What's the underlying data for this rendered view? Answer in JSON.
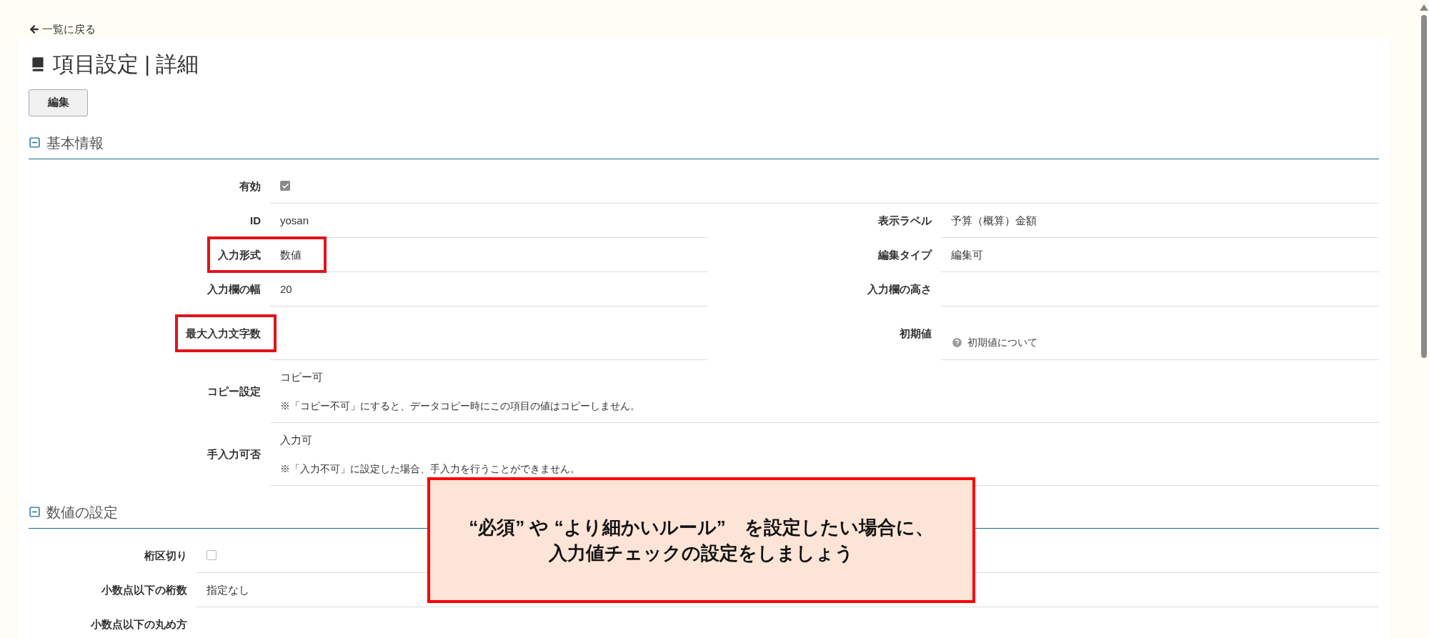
{
  "back_link": "一覧に戻る",
  "title": "項目設定 | 詳細",
  "edit_button": "編集",
  "sections": [
    {
      "title": "基本情報",
      "expanded": true,
      "rows": [
        {
          "left": {
            "label": "有効",
            "kind": "checkbox",
            "checked": true
          }
        },
        {
          "left": {
            "label": "ID",
            "kind": "text",
            "value": "yosan"
          },
          "right": {
            "label": "表示ラベル",
            "kind": "text",
            "value": "予算（概算）金額"
          }
        },
        {
          "left": {
            "label": "入力形式",
            "kind": "text",
            "value": "数値",
            "label_highlighted": true,
            "value_highlighted": true
          },
          "right": {
            "label": "編集タイプ",
            "kind": "text",
            "value": "編集可"
          }
        },
        {
          "left": {
            "label": "入力欄の幅",
            "kind": "text",
            "value": "20"
          },
          "right": {
            "label": "入力欄の高さ",
            "kind": "text"
          }
        },
        {
          "left": {
            "label": "最大入力文字数",
            "kind": "text",
            "label_highlighted": true,
            "value_highlighted": false
          },
          "right": {
            "label": "初期値",
            "kind": "help",
            "link": "初期値について"
          }
        },
        {
          "left": {
            "label": "コピー設定",
            "kind": "text",
            "value": "コピー可",
            "note": "※「コピー不可」にすると、データコピー時にこの項目の値はコピーしません。"
          }
        },
        {
          "left": {
            "label": "手入力可否",
            "kind": "text",
            "value": "入力可",
            "note": "※「入力不可」に設定した場合、手入力を行うことができません。"
          }
        }
      ]
    },
    {
      "title": "数値の設定",
      "expanded": true,
      "rows": [
        {
          "left": {
            "label": "桁区切り",
            "kind": "checkbox",
            "checked": false
          }
        },
        {
          "left": {
            "label": "小数点以下の桁数",
            "kind": "text",
            "value": "指定なし"
          }
        },
        {
          "left": {
            "label": "小数点以下の丸め方",
            "kind": "text"
          }
        }
      ]
    }
  ],
  "callout": {
    "lines": [
      "“必須” や “より細かいルール”　を設定したい場合に、",
      "入力値チェックの設定をしましょう"
    ]
  }
}
